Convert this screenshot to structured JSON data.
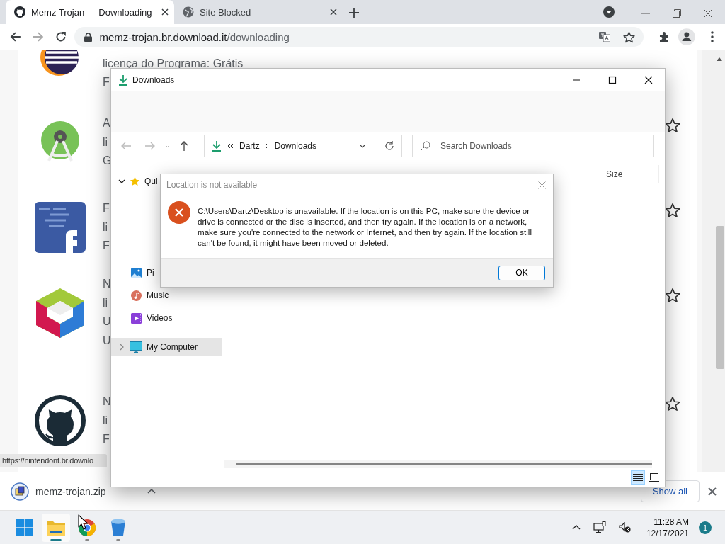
{
  "browser": {
    "tabs": [
      {
        "title": "Memz Trojan — Downloading",
        "kind": "cat",
        "selected": true
      },
      {
        "title": "Site Blocked",
        "kind": "globe",
        "selected": false
      }
    ],
    "address": {
      "host": "memz-trojan.br.download.it",
      "path": "/downloading"
    },
    "page": {
      "rows": [
        {
          "kind": "striped",
          "lines": [
            "licença do Programa: Grátis",
            "F"
          ]
        },
        {
          "kind": "robot",
          "lines": [
            "A",
            "li",
            "G"
          ]
        },
        {
          "kind": "code",
          "lines": [
            "F",
            "li",
            "F"
          ]
        },
        {
          "kind": "cube",
          "lines": [
            "N",
            "li",
            "U",
            "U"
          ]
        },
        {
          "kind": "cat",
          "lines": [
            "N",
            "li",
            "F"
          ]
        }
      ]
    },
    "status_url": "https://nintendont.br.downlo",
    "downloads_shelf": {
      "file": "memz-trojan.zip",
      "show_all": "Show all"
    }
  },
  "explorer": {
    "title": "Downloads",
    "breadcrumb": [
      "Dartz",
      "Downloads"
    ],
    "search": {
      "placeholder": "Search Downloads"
    },
    "columns": [
      "Size"
    ],
    "nav": [
      {
        "label": "Qui",
        "kind": "star",
        "expanded": true,
        "selected": false,
        "children": [
          {
            "label": "Pi",
            "kind": "pictures",
            "selected": false
          },
          {
            "label": "Music",
            "kind": "music",
            "selected": false
          },
          {
            "label": "Videos",
            "kind": "videos",
            "selected": false
          }
        ]
      },
      {
        "label": "My Computer",
        "kind": "computer",
        "expanded": false,
        "selected": true
      }
    ],
    "views": [
      {
        "kind": "details",
        "selected": true
      },
      {
        "kind": "tiles",
        "selected": false
      }
    ]
  },
  "dialog": {
    "title": "Location is not available",
    "message": "C:\\Users\\Dartz\\Desktop is unavailable. If the location is on this PC, make sure the device or drive is connected or the disc is inserted, and then try again. If the location is on a network, make sure you're connected to the network or Internet, and then try again. If the location still can't be found, it might have been moved or deleted.",
    "button": "OK"
  },
  "taskbar": {
    "apps": [
      {
        "kind": "start",
        "running": false,
        "focused": false
      },
      {
        "kind": "folder",
        "running": true,
        "focused": true
      },
      {
        "kind": "browser",
        "running": true,
        "focused": false
      },
      {
        "kind": "bucket",
        "running": true,
        "focused": false
      }
    ],
    "time": "11:28 AM",
    "date": "12/17/2021",
    "notifications": "1"
  }
}
